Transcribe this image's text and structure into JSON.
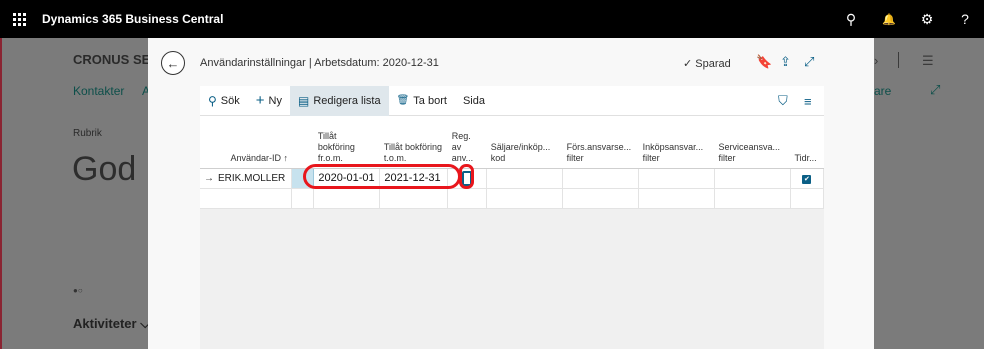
{
  "topbar": {
    "app_title": "Dynamics 365 Business Central",
    "icons": [
      "search-icon",
      "bell-icon",
      "gear-icon",
      "help-icon"
    ],
    "glyphs": {
      "search": "⚲",
      "bell": "🔔",
      "gear": "⚙",
      "help": "?"
    }
  },
  "background": {
    "company": "CRONUS SE",
    "link_kontakter": "Kontakter",
    "link_a": "A",
    "link_are": "are",
    "rubrik": "Rubrik",
    "god": "God",
    "dots": "●○",
    "aktiviteter": "Aktiviteter ⌵",
    "glyph_chevron": "›",
    "glyph_menu": "☰",
    "glyph_expand": "⤢"
  },
  "dialog": {
    "back_glyph": "←",
    "breadcrumb": "Användarinställningar | Arbetsdatum: 2020-12-31",
    "saved": "✓ Sparad",
    "glyphs": {
      "bookmark": "🔖",
      "share": "⇪",
      "expand": "⤢"
    }
  },
  "actions": {
    "search": "Sök",
    "search_glyph": "⚲",
    "new": "Ny",
    "new_glyph": "+",
    "edit_list": "Redigera lista",
    "edit_glyph": "▤",
    "delete": "Ta bort",
    "delete_glyph": "🗑",
    "page": "Sida",
    "filter_glyph": "⛉",
    "list_glyph": "≡"
  },
  "table": {
    "headers": {
      "user_id": "Användar-ID ↑",
      "allow_from": "Tillåt bokföring fr.o.m.",
      "allow_to": "Tillåt bokföring t.o.m.",
      "reg": "Reg. av anv...",
      "salesperson": "Säljare/inköp... kod",
      "sales_resp": "Förs.ansvarse... filter",
      "purch_resp": "Inköpsansvar... filter",
      "service_resp": "Serviceansva... filter",
      "time": "Tidr..."
    },
    "rows": [
      {
        "arrow": "→",
        "user_id": "ERIK.MOLLER",
        "allow_from": "2020-01-01",
        "allow_to": "2021-12-31",
        "time_checked": "✔"
      }
    ]
  },
  "colors": {
    "accent": "#0b5f86",
    "highlight": "#e8161c",
    "selected_cell": "#c7e2ee",
    "topbar": "#000000"
  }
}
